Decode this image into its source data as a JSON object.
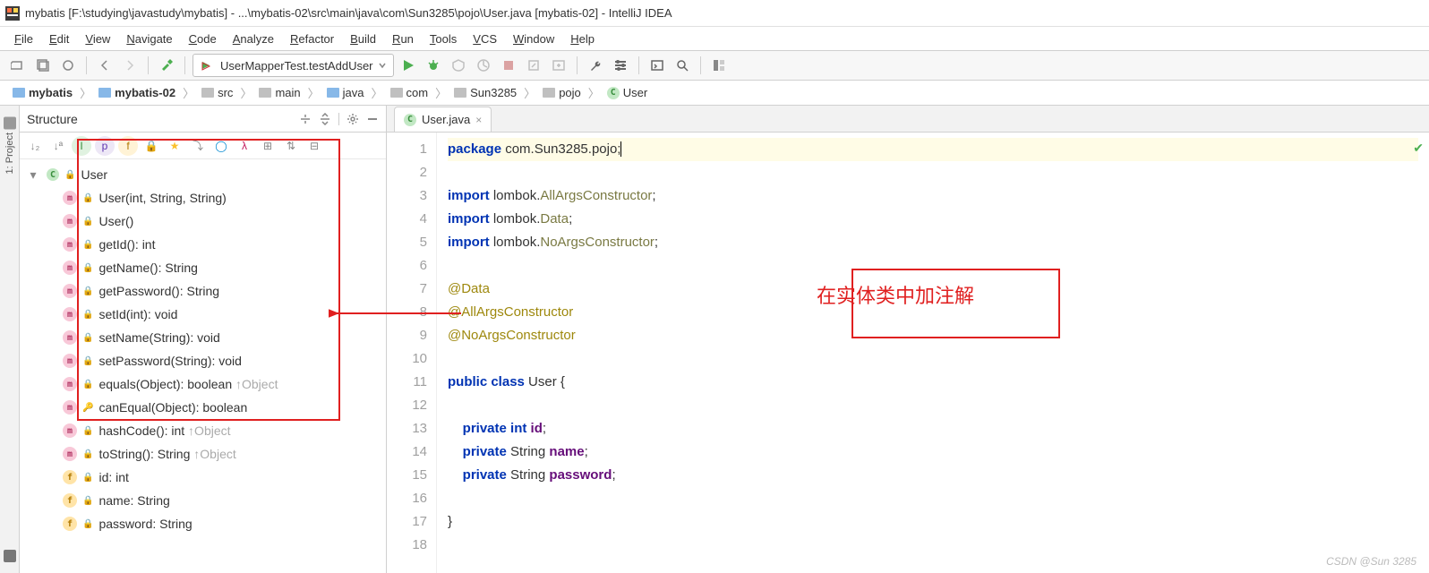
{
  "window": {
    "title": "mybatis [F:\\studying\\javastudy\\mybatis] - ...\\mybatis-02\\src\\main\\java\\com\\Sun3285\\pojo\\User.java [mybatis-02] - IntelliJ IDEA"
  },
  "menu": [
    "File",
    "Edit",
    "View",
    "Navigate",
    "Code",
    "Analyze",
    "Refactor",
    "Build",
    "Run",
    "Tools",
    "VCS",
    "Window",
    "Help"
  ],
  "run_config": "UserMapperTest.testAddUser",
  "breadcrumb": [
    {
      "label": "mybatis",
      "icon": "blue",
      "bold": true
    },
    {
      "label": "mybatis-02",
      "icon": "blue",
      "bold": true
    },
    {
      "label": "src",
      "icon": "gray"
    },
    {
      "label": "main",
      "icon": "gray"
    },
    {
      "label": "java",
      "icon": "blue"
    },
    {
      "label": "com",
      "icon": "gray"
    },
    {
      "label": "Sun3285",
      "icon": "gray"
    },
    {
      "label": "pojo",
      "icon": "gray"
    },
    {
      "label": "User",
      "icon": "class"
    }
  ],
  "gutter": {
    "project": "1: Project"
  },
  "structure": {
    "title": "Structure",
    "root": "User",
    "members": [
      {
        "icon": "m",
        "text": "User(int, String, String)"
      },
      {
        "icon": "m",
        "text": "User()"
      },
      {
        "icon": "m",
        "text": "getId(): int"
      },
      {
        "icon": "m",
        "text": "getName(): String"
      },
      {
        "icon": "m",
        "text": "getPassword(): String"
      },
      {
        "icon": "m",
        "text": "setId(int): void"
      },
      {
        "icon": "m",
        "text": "setName(String): void"
      },
      {
        "icon": "m",
        "text": "setPassword(String): void"
      },
      {
        "icon": "m",
        "text": "equals(Object): boolean",
        "tail": " ↑Object"
      },
      {
        "icon": "m",
        "text": "canEqual(Object): boolean",
        "key": true
      },
      {
        "icon": "m",
        "text": "hashCode(): int",
        "tail": " ↑Object"
      },
      {
        "icon": "m",
        "text": "toString(): String",
        "tail": " ↑Object"
      },
      {
        "icon": "f",
        "text": "id: int",
        "lock": true
      },
      {
        "icon": "f",
        "text": "name: String",
        "lock": true
      },
      {
        "icon": "f",
        "text": "password: String",
        "lock": true
      }
    ]
  },
  "editor": {
    "tab": "User.java",
    "annotation_text": "在实体类中加注解",
    "lines": [
      {
        "n": 1,
        "hl": true,
        "html": "<span class='kw'>package</span> com.Sun3285.pojo;<span class='cursor'></span>"
      },
      {
        "n": 2,
        "html": ""
      },
      {
        "n": 3,
        "html": "<span class='kw'>import</span> lombok.<span class='cls'>AllArgsConstructor</span>;"
      },
      {
        "n": 4,
        "html": "<span class='kw'>import</span> lombok.<span class='cls'>Data</span>;"
      },
      {
        "n": 5,
        "html": "<span class='kw'>import</span> lombok.<span class='cls'>NoArgsConstructor</span>;"
      },
      {
        "n": 6,
        "html": ""
      },
      {
        "n": 7,
        "html": "<span class='ann'>@Data</span>"
      },
      {
        "n": 8,
        "html": "<span class='ann'>@AllArgsConstructor</span>"
      },
      {
        "n": 9,
        "html": "<span class='ann'>@NoArgsConstructor</span>"
      },
      {
        "n": 10,
        "html": ""
      },
      {
        "n": 11,
        "html": "<span class='kw'>public</span> <span class='kw'>class</span> User {"
      },
      {
        "n": 12,
        "html": ""
      },
      {
        "n": 13,
        "html": "    <span class='kw'>private</span> <span class='kw'>int</span> <span class='fld'>id</span>;"
      },
      {
        "n": 14,
        "html": "    <span class='kw'>private</span> String <span class='fld'>name</span>;"
      },
      {
        "n": 15,
        "html": "    <span class='kw'>private</span> String <span class='fld'>password</span>;"
      },
      {
        "n": 16,
        "html": ""
      },
      {
        "n": 17,
        "html": "}"
      },
      {
        "n": 18,
        "html": ""
      }
    ]
  },
  "watermark": "CSDN @Sun 3285"
}
